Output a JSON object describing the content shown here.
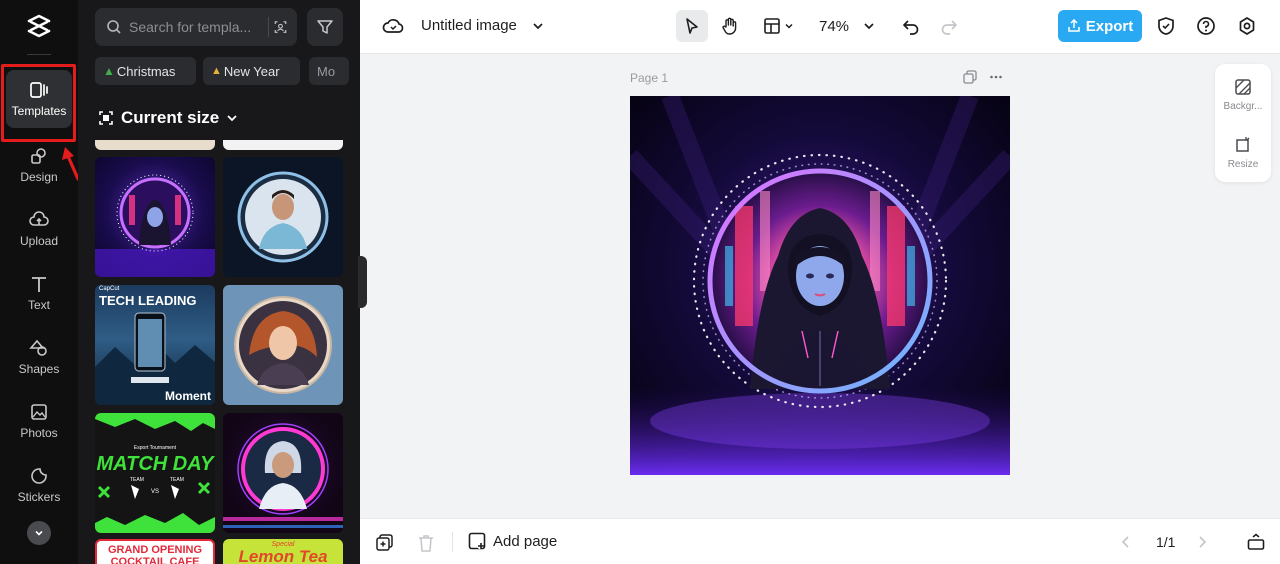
{
  "colors": {
    "accent": "#29a9f1",
    "highlight": "#e51c1c",
    "rail_bg": "#0f0f10",
    "panel_bg": "#18181a"
  },
  "rail": {
    "items": [
      {
        "label": "Templates",
        "icon": "templates-icon",
        "active": true
      },
      {
        "label": "Design",
        "icon": "design-icon"
      },
      {
        "label": "Upload",
        "icon": "upload-icon"
      },
      {
        "label": "Text",
        "icon": "text-icon"
      },
      {
        "label": "Shapes",
        "icon": "shapes-icon"
      },
      {
        "label": "Photos",
        "icon": "photos-icon"
      },
      {
        "label": "Stickers",
        "icon": "stickers-icon"
      }
    ]
  },
  "panel": {
    "search_placeholder": "Search for templa...",
    "chips": [
      "Christmas",
      "New Year",
      "Mo"
    ],
    "size_label": "Current size",
    "tiles": {
      "tech": {
        "title": "TECH LEADING",
        "footer": "Moment",
        "brand": "CapCut"
      },
      "match": {
        "pre": "Esport Tournament",
        "title": "MATCH DAY",
        "team": "TEAM",
        "vs": "VS"
      },
      "grand": {
        "line1": "GRAND OPENING",
        "line2": "COCKTAIL CAFE"
      },
      "lemon": {
        "pre": "Special",
        "title": "Lemon Tea"
      }
    }
  },
  "topbar": {
    "title": "Untitled image",
    "zoom": "74%",
    "export_label": "Export"
  },
  "canvas": {
    "page_label": "Page 1"
  },
  "right_tools": [
    {
      "label": "Backgr...",
      "icon": "background-icon"
    },
    {
      "label": "Resize",
      "icon": "resize-icon"
    }
  ],
  "bottombar": {
    "add_page_label": "Add page",
    "pagination": "1/1"
  }
}
